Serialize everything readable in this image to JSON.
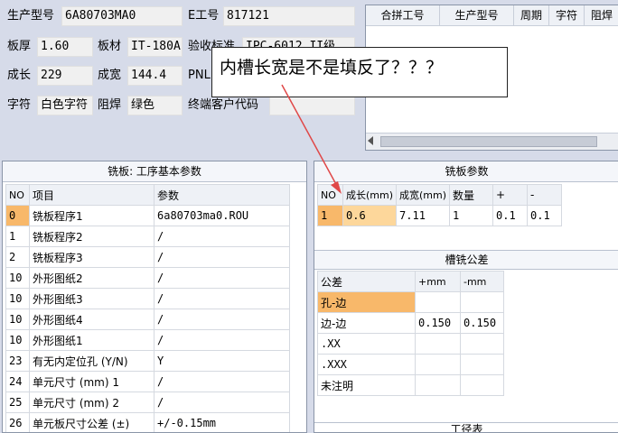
{
  "info": {
    "model_label": "生产型号",
    "model_value": "6A80703MA0",
    "e_label": "E工号",
    "e_value": "817121",
    "thick_label": "板厚",
    "thick_value": "1.60",
    "material_label": "板材",
    "material_value": "IT-180A",
    "standard_label": "验收标准",
    "standard_value": "IPC-6012 II级",
    "len_label": "成长",
    "len_value": "229",
    "wid_label": "成宽",
    "wid_value": "144.4",
    "pnl_label": "PNL",
    "char_label": "字符",
    "char_value": "白色字符",
    "mask_label": "阻焊",
    "mask_value": "绿色",
    "customer_label": "终端客户代码",
    "customer_value": ""
  },
  "merge_table": {
    "headers": [
      "合拼工号",
      "生产型号",
      "周期",
      "字符",
      "阻焊"
    ]
  },
  "callout_text": "内槽长宽是不是填反了？？？",
  "milling_basic": {
    "title": "铣板: 工序基本参数",
    "headers": [
      "NO",
      "项目",
      "参数"
    ],
    "rows": [
      [
        "0",
        "铣板程序1",
        "6a80703ma0.ROU"
      ],
      [
        "1",
        "铣板程序2",
        "/"
      ],
      [
        "2",
        "铣板程序3",
        "/"
      ],
      [
        "10",
        "外形图纸2",
        "/"
      ],
      [
        "10",
        "外形图纸3",
        "/"
      ],
      [
        "10",
        "外形图纸4",
        "/"
      ],
      [
        "10",
        "外形图纸1",
        "/"
      ],
      [
        "23",
        "有无内定位孔 (Y/N)",
        "Y"
      ],
      [
        "24",
        "单元尺寸 (mm) 1",
        "/"
      ],
      [
        "25",
        "单元尺寸 (mm) 2",
        "/"
      ],
      [
        "26",
        "单元板尺寸公差 (±)",
        "+/-0.15mm"
      ]
    ]
  },
  "milling_params": {
    "title": "铣板参数",
    "headers": [
      "NO",
      "成长(mm)",
      "成宽(mm)",
      "数量",
      "+",
      "-"
    ],
    "rows": [
      [
        "1",
        "0.6",
        "7.11",
        "1",
        "0.1",
        "0.1"
      ]
    ]
  },
  "slot_tolerance": {
    "title": "槽铣公差",
    "headers": [
      "公差",
      "+mm",
      "-mm"
    ],
    "rows": [
      [
        "孔-边",
        "",
        ""
      ],
      [
        "边-边",
        "0.150",
        "0.150"
      ],
      [
        ".XX",
        "",
        ""
      ],
      [
        ".XXX",
        "",
        ""
      ],
      [
        "未注明",
        "",
        ""
      ]
    ]
  },
  "bottom_title": "工径表"
}
